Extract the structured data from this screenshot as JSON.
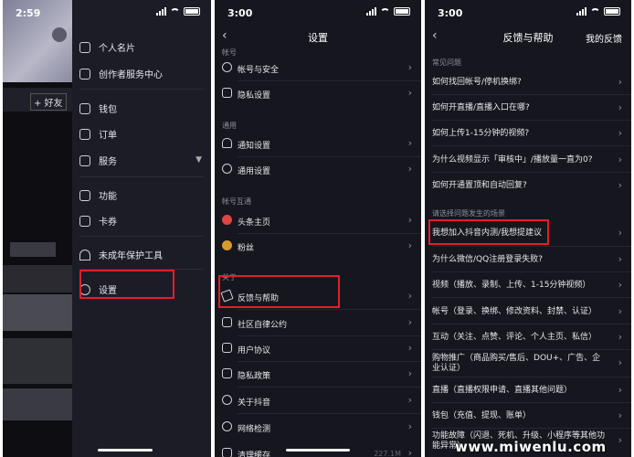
{
  "panel1": {
    "time": "2:59",
    "friend_btn": "+ 好友",
    "drawer_items": [
      {
        "label": "个人名片",
        "icon": "id-card-icon"
      },
      {
        "label": "创作者服务中心",
        "icon": "chart-icon"
      },
      {
        "label": "钱包",
        "icon": "wallet-icon"
      },
      {
        "label": "订单",
        "icon": "order-icon"
      },
      {
        "label": "服务",
        "icon": "services-icon"
      },
      {
        "label": "功能",
        "icon": "function-icon"
      },
      {
        "label": "卡券",
        "icon": "coupon-icon"
      },
      {
        "label": "未成年保护工具",
        "icon": "umbrella-icon"
      },
      {
        "label": "设置",
        "icon": "gear-icon"
      }
    ]
  },
  "panel2": {
    "time": "3:00",
    "title": "设置",
    "sections": {
      "account": "帐号",
      "general": "通用",
      "interop": "帐号互通",
      "about": "关于"
    },
    "rows": [
      {
        "label": "帐号与安全",
        "icon": "user-icon"
      },
      {
        "label": "隐私设置",
        "icon": "lock-icon"
      },
      {
        "label": "通知设置",
        "icon": "bell-icon"
      },
      {
        "label": "通用设置",
        "icon": "settings-icon"
      },
      {
        "label": "头条主页",
        "icon": "toutiao-icon"
      },
      {
        "label": "粉丝",
        "icon": "fans-icon"
      },
      {
        "label": "反馈与帮助",
        "icon": "edit-icon"
      },
      {
        "label": "社区自律公约",
        "icon": "document-icon"
      },
      {
        "label": "用户协议",
        "icon": "book-icon"
      },
      {
        "label": "隐私政策",
        "icon": "shield-icon"
      },
      {
        "label": "关于抖音",
        "icon": "info-icon"
      },
      {
        "label": "网络检测",
        "icon": "globe-icon"
      },
      {
        "label": "清理缓存",
        "icon": "trash-icon",
        "value": "227.1M"
      }
    ]
  },
  "panel3": {
    "time": "3:00",
    "title": "反馈与帮助",
    "right_action": "我的反馈",
    "section_common": "常见问题",
    "section_scene": "请选择问题发生的场景",
    "faq": [
      "如何找回帐号/停机换绑?",
      "如何开直播/直播入口在哪?",
      "如何上传1-15分钟的视频?",
      "为什么视频显示「审核中」/播放量一直为0?",
      "如何开通置顶和自动回复?"
    ],
    "scenes": [
      "我想加入抖音内测/我想提建议",
      "为什么微信/QQ注册登录失败?",
      "视频（播放、录制、上传、1-15分钟视频）",
      "帐号（登录、换绑、修改资料、封禁、认证）",
      "互动（关注、点赞、评论、个人主页、私信）",
      "购物推广（商品购买/售后、DOU+、广告、企业认证）",
      "直播（直播权限申请、直播其他问题）",
      "钱包（充值、提现、账单）",
      "功能故障（闪退、死机、升级、小程序等其他功能异常）"
    ]
  },
  "watermark": "www.miwenlu.com",
  "colors": {
    "highlight": "#e0202a",
    "bg": "#16161f"
  }
}
